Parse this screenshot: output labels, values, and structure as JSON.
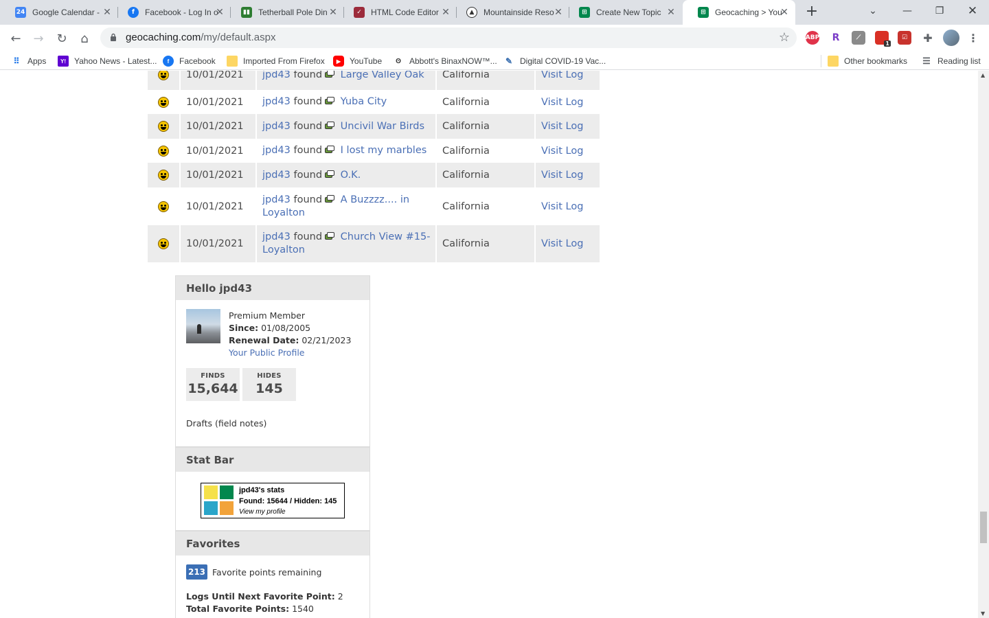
{
  "browser": {
    "tabs": [
      {
        "title": "Google Calendar -",
        "icon": "google-calendar-icon",
        "color": "#4285f4"
      },
      {
        "title": "Facebook - Log In o",
        "icon": "facebook-icon",
        "color": "#1877f2"
      },
      {
        "title": "Tetherball Pole Din",
        "icon": "tetherball-icon",
        "color": "#2e7d32"
      },
      {
        "title": "HTML Code Editor",
        "icon": "html-editor-icon",
        "color": "#9c2b3b"
      },
      {
        "title": "Mountainside Reso",
        "icon": "mountainside-icon",
        "color": "#333333"
      },
      {
        "title": "Create New Topic",
        "icon": "geocaching-icon",
        "color": "#02874d"
      },
      {
        "title": "Geocaching > Your",
        "icon": "geocaching-icon",
        "color": "#02874d",
        "active": true
      }
    ],
    "url_host": "geocaching.com",
    "url_path": "/my/default.aspx",
    "bookmarks": [
      {
        "label": "Apps"
      },
      {
        "label": "Yahoo News - Latest..."
      },
      {
        "label": "Facebook"
      },
      {
        "label": "Imported From Firefox"
      },
      {
        "label": "YouTube"
      },
      {
        "label": "Abbott's BinaxNOW™..."
      },
      {
        "label": "Digital COVID-19 Vac..."
      },
      {
        "label": "Other bookmarks"
      },
      {
        "label": "Reading list"
      }
    ],
    "extensions": {
      "abp": "ABP",
      "r": "R",
      "badge": "1"
    }
  },
  "logs": {
    "user": "jpd43",
    "verb": "found",
    "visit_label": "Visit Log",
    "rows": [
      {
        "date": "10/01/2021",
        "cache": "Large Valley Oak",
        "state": "California"
      },
      {
        "date": "10/01/2021",
        "cache": "Yuba City",
        "state": "California"
      },
      {
        "date": "10/01/2021",
        "cache": "Uncivil War Birds",
        "state": "California"
      },
      {
        "date": "10/01/2021",
        "cache": "I lost my marbles",
        "state": "California"
      },
      {
        "date": "10/01/2021",
        "cache": "O.K.",
        "state": "California"
      },
      {
        "date": "10/01/2021",
        "cache": "A Buzzzz.... in Loyalton",
        "state": "California"
      },
      {
        "date": "10/01/2021",
        "cache": "Church View #15- Loyalton",
        "state": "California"
      }
    ]
  },
  "profile": {
    "hello": "Hello jpd43",
    "membership": "Premium Member",
    "since_label": "Since:",
    "since": "01/08/2005",
    "renewal_label": "Renewal Date:",
    "renewal": "02/21/2023",
    "public_profile": "Your Public Profile",
    "finds_label": "FINDS",
    "finds": "15,644",
    "hides_label": "HIDES",
    "hides": "145",
    "drafts": "Drafts (field notes)"
  },
  "statbar": {
    "heading": "Stat Bar",
    "title": "jpd43's stats",
    "found_line": "Found: 15644 / Hidden: 145",
    "view": "View my profile"
  },
  "favorites": {
    "heading": "Favorites",
    "remaining": "213",
    "remaining_text": "Favorite points remaining",
    "next_label": "Logs Until Next Favorite Point:",
    "next_value": "2",
    "total_label": "Total Favorite Points:",
    "total_value": "1540"
  }
}
